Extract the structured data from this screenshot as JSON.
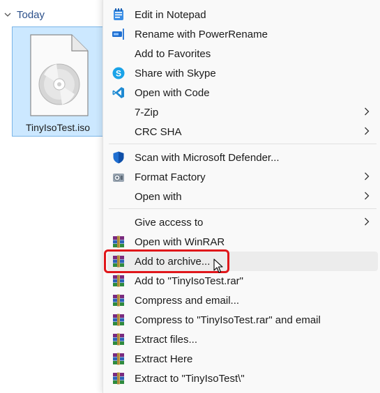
{
  "explorer": {
    "group_label": "Today",
    "file": {
      "name": "TinyIsoTest.iso",
      "icon": "disc-image-file-icon"
    }
  },
  "menu": {
    "items": [
      {
        "label": "Edit in Notepad",
        "icon": "notepad-icon"
      },
      {
        "label": "Rename with PowerRename",
        "icon": "powerrename-icon"
      },
      {
        "label": "Add to Favorites",
        "icon": ""
      },
      {
        "label": "Share with Skype",
        "icon": "skype-icon"
      },
      {
        "label": "Open with Code",
        "icon": "vscode-icon"
      },
      {
        "label": "7-Zip",
        "icon": "",
        "submenu": true
      },
      {
        "label": "CRC SHA",
        "icon": "",
        "submenu": true
      },
      {
        "label": "Scan with Microsoft Defender...",
        "icon": "defender-shield-icon"
      },
      {
        "label": "Format Factory",
        "icon": "format-factory-icon",
        "submenu": true
      },
      {
        "label": "Open with",
        "icon": "",
        "submenu": true
      },
      {
        "label": "Give access to",
        "icon": "",
        "submenu": true
      },
      {
        "label": "Open with WinRAR",
        "icon": "winrar-icon"
      },
      {
        "label": "Add to archive...",
        "icon": "winrar-icon",
        "highlighted": true
      },
      {
        "label": "Add to \"TinyIsoTest.rar\"",
        "icon": "winrar-icon"
      },
      {
        "label": "Compress and email...",
        "icon": "winrar-icon"
      },
      {
        "label": "Compress to \"TinyIsoTest.rar\" and email",
        "icon": "winrar-icon"
      },
      {
        "label": "Extract files...",
        "icon": "winrar-icon"
      },
      {
        "label": "Extract Here",
        "icon": "winrar-icon"
      },
      {
        "label": "Extract to \"TinyIsoTest\\\"",
        "icon": "winrar-icon"
      }
    ]
  },
  "colors": {
    "highlight_border": "#e0161a",
    "selection_bg": "#cce8ff",
    "menu_bg": "#f9f9f9"
  }
}
